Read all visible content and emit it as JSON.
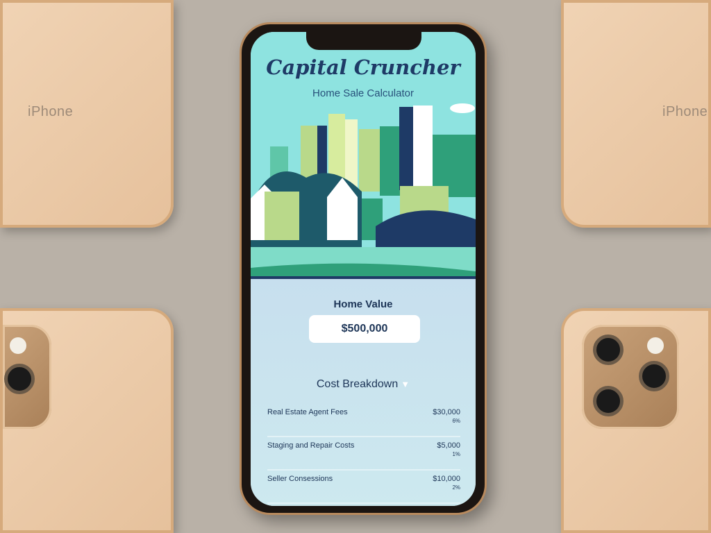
{
  "background_phones": {
    "label": "iPhone"
  },
  "app": {
    "title": "Capital Cruncher",
    "subtitle": "Home Sale Calculator",
    "home_value": {
      "label": "Home Value",
      "value": "$500,000"
    },
    "cost_breakdown": {
      "title": "Cost Breakdown",
      "items": [
        {
          "name": "Real Estate Agent Fees",
          "amount": "$30,000",
          "percent": "6%"
        },
        {
          "name": "Staging and Repair Costs",
          "amount": "$5,000",
          "percent": "1%"
        },
        {
          "name": "Seller Consessions",
          "amount": "$10,000",
          "percent": "2%"
        }
      ]
    }
  },
  "colors": {
    "primary": "#1d3557",
    "hero_bg": "#8ee3e0",
    "panel_bg": "#c9e6ee"
  }
}
